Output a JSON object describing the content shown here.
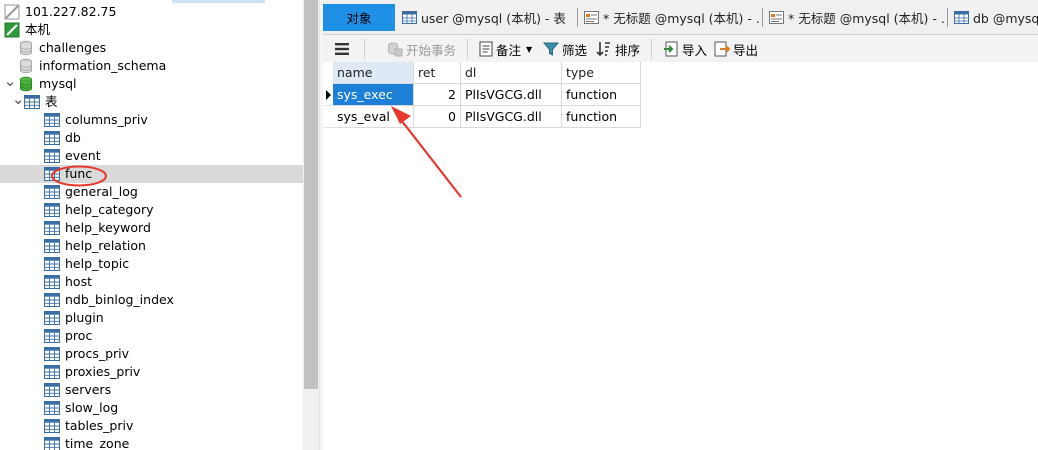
{
  "sidebar": {
    "connection": "101.227.82.75",
    "items": [
      {
        "label": "本机",
        "kind": "connection",
        "indent": 0
      },
      {
        "label": "challenges",
        "kind": "database",
        "indent": 1
      },
      {
        "label": "information_schema",
        "kind": "database",
        "indent": 1
      },
      {
        "label": "mysql",
        "kind": "database-open",
        "indent": 1,
        "expanded": true
      },
      {
        "label": "表",
        "kind": "tables-folder",
        "indent": 2,
        "expanded": true
      },
      {
        "label": "columns_priv",
        "kind": "table",
        "indent": 3
      },
      {
        "label": "db",
        "kind": "table",
        "indent": 3
      },
      {
        "label": "event",
        "kind": "table",
        "indent": 3
      },
      {
        "label": "func",
        "kind": "table",
        "indent": 3,
        "selected": true
      },
      {
        "label": "general_log",
        "kind": "table",
        "indent": 3
      },
      {
        "label": "help_category",
        "kind": "table",
        "indent": 3
      },
      {
        "label": "help_keyword",
        "kind": "table",
        "indent": 3
      },
      {
        "label": "help_relation",
        "kind": "table",
        "indent": 3
      },
      {
        "label": "help_topic",
        "kind": "table",
        "indent": 3
      },
      {
        "label": "host",
        "kind": "table",
        "indent": 3
      },
      {
        "label": "ndb_binlog_index",
        "kind": "table",
        "indent": 3
      },
      {
        "label": "plugin",
        "kind": "table",
        "indent": 3
      },
      {
        "label": "proc",
        "kind": "table",
        "indent": 3
      },
      {
        "label": "procs_priv",
        "kind": "table",
        "indent": 3
      },
      {
        "label": "proxies_priv",
        "kind": "table",
        "indent": 3
      },
      {
        "label": "servers",
        "kind": "table",
        "indent": 3
      },
      {
        "label": "slow_log",
        "kind": "table",
        "indent": 3
      },
      {
        "label": "tables_priv",
        "kind": "table",
        "indent": 3
      },
      {
        "label": "time_zone",
        "kind": "table",
        "indent": 3
      }
    ]
  },
  "tabs": [
    {
      "label": "对象",
      "icon": "none",
      "active": true
    },
    {
      "label": "user @mysql (本机) - 表",
      "icon": "table-icon"
    },
    {
      "label": "* 无标题 @mysql (本机) - ...",
      "icon": "query-icon"
    },
    {
      "label": "* 无标题 @mysql (本机) - ...",
      "icon": "query-icon"
    },
    {
      "label": "db @mysql (本机) -",
      "icon": "table-icon"
    }
  ],
  "toolbar": {
    "begin_transaction": "开始事务",
    "note": "备注",
    "filter": "筛选",
    "sort": "排序",
    "import": "导入",
    "export": "导出"
  },
  "grid": {
    "columns": [
      "name",
      "ret",
      "dl",
      "type"
    ],
    "sorted_column": "name",
    "rows": [
      {
        "name": "sys_exec",
        "ret": "2",
        "dl": "PlIsVGCG.dll",
        "type": "function",
        "current": true
      },
      {
        "name": "sys_eval",
        "ret": "0",
        "dl": "PlIsVGCG.dll",
        "type": "function",
        "current": false
      }
    ]
  },
  "colors": {
    "active_tab": "#1e90e6",
    "selected_cell": "#1e7fd6",
    "annotation": "#e8372e",
    "selected_tree_row": "#d9d9d9"
  }
}
